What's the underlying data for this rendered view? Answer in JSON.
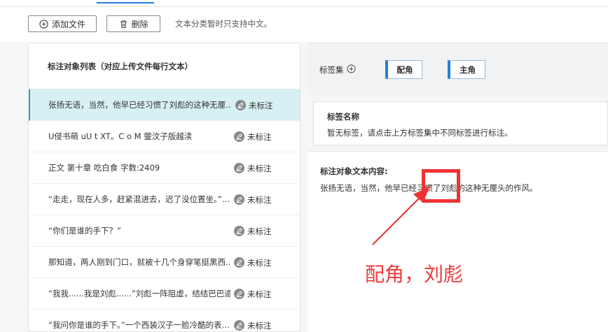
{
  "toolbar": {
    "add_label": "添加文件",
    "delete_label": "删除",
    "hint": "文本分类暂时只支持中文。"
  },
  "left": {
    "header": "标注对象列表（对应上传文件每行文本）",
    "items": [
      {
        "text": "张扬无语，当然，他早已经习惯了刘彪的这种无厘...",
        "status": "未标注",
        "selected": true
      },
      {
        "text": "U侵书萌 uU t XT。C o M 蓥汶子版越渎",
        "status": "未标注"
      },
      {
        "text": "正文 第十章 吃白食 字数:2409",
        "status": "未标注"
      },
      {
        "text": "“走走，现在人多，赶紧混进去，迟了没位置坐。”...",
        "status": "未标注"
      },
      {
        "text": "“你们是谁的手下？”",
        "status": "未标注"
      },
      {
        "text": "那知道，两人刚到门口，就被十几个身穿笔挺黑西...",
        "status": "未标注"
      },
      {
        "text": "“我我......我是刘彪......”刘彪一阵阻虚，结结巴巴道。",
        "status": "未标注"
      },
      {
        "text": "“我问你是谁的手下。”一个西装汉子一脸冷酷的表...",
        "status": "未标注"
      }
    ]
  },
  "tagset": {
    "label": "标签集",
    "tags": [
      "配角",
      "主角"
    ]
  },
  "tagname": {
    "title": "标签名称",
    "desc": "暂无标签，请点击上方标签集中不同标签进行标注。"
  },
  "content": {
    "title": "标注对象文本内容:",
    "body": "张扬无语，当然，他早已经习惯了刘彪的这种无厘头的作风。"
  },
  "annotation": {
    "text": "配角，刘彪",
    "color": "#f03a3a"
  }
}
